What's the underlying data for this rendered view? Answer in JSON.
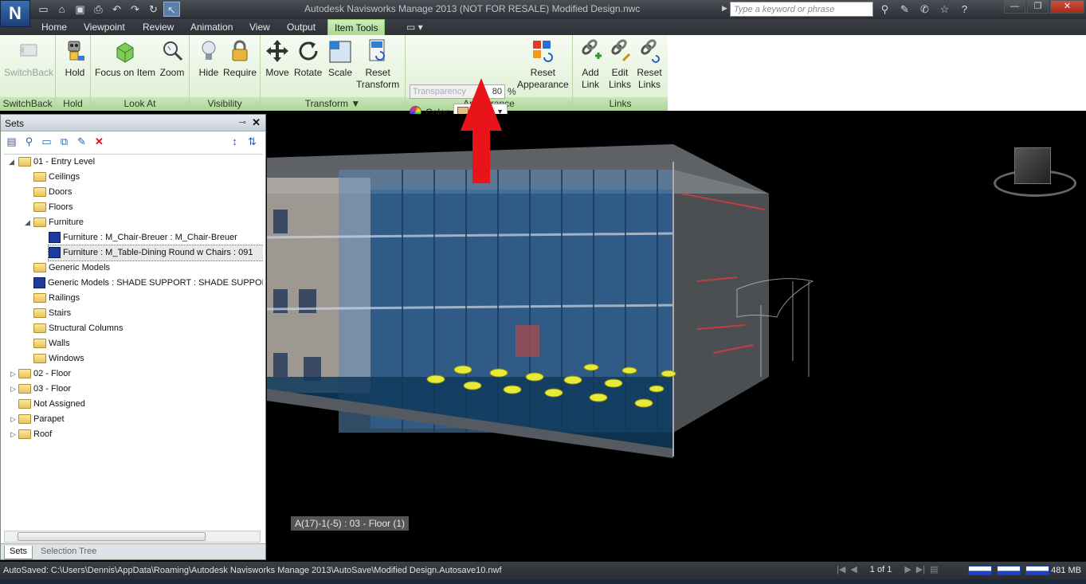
{
  "window": {
    "title": "Autodesk Navisworks Manage 2013 (NOT FOR RESALE)    Modified Design.nwc",
    "search_placeholder": "Type a keyword or phrase",
    "logo_letter": "N",
    "controls": {
      "minimize": "—",
      "restore": "❐",
      "close": "✕"
    }
  },
  "qat_icons": [
    "new-file-icon",
    "open-icon",
    "save-icon",
    "print-icon",
    "undo-icon",
    "redo-icon",
    "refresh-icon",
    "select-icon"
  ],
  "tabs": [
    {
      "label": "Home"
    },
    {
      "label": "Viewpoint"
    },
    {
      "label": "Review"
    },
    {
      "label": "Animation"
    },
    {
      "label": "View"
    },
    {
      "label": "Output"
    },
    {
      "label": "Item Tools"
    }
  ],
  "ribbon": {
    "switchback": {
      "button": "SwitchBack",
      "panel": "SwitchBack"
    },
    "hold": {
      "button": "Hold",
      "panel": "Hold"
    },
    "lookat": {
      "focus": "Focus on Item",
      "zoom": "Zoom",
      "panel": "Look At"
    },
    "visibility": {
      "hide": "Hide",
      "require": "Require",
      "panel": "Visibility"
    },
    "transform": {
      "move": "Move",
      "rotate": "Rotate",
      "scale": "Scale",
      "reset_1": "Reset",
      "reset_2": "Transform",
      "panel": "Transform ▼"
    },
    "appearance": {
      "transparency_placeholder": "Transparency",
      "transparency_value": "80",
      "unit": "%",
      "color_label": "Color:",
      "color_swatch": "#e1c08d",
      "reset_1": "Reset",
      "reset_2": "Appearance",
      "panel": "Appearance"
    },
    "links": {
      "add_1": "Add",
      "add_2": "Link",
      "edit_1": "Edit",
      "edit_2": "Links",
      "reset_1": "Reset",
      "reset_2": "Links",
      "panel": "Links"
    }
  },
  "sets_panel": {
    "title": "Sets",
    "tree": [
      {
        "label": "01 - Entry Level",
        "kind": "folder",
        "level": 0,
        "expanded": true
      },
      {
        "label": "Ceilings",
        "kind": "folder",
        "level": 1
      },
      {
        "label": "Doors",
        "kind": "folder",
        "level": 1
      },
      {
        "label": "Floors",
        "kind": "folder",
        "level": 1
      },
      {
        "label": "Furniture",
        "kind": "folder",
        "level": 1,
        "expanded": true
      },
      {
        "label": "Furniture : M_Chair-Breuer : M_Chair-Breuer",
        "kind": "item",
        "level": 2
      },
      {
        "label": "Furniture : M_Table-Dining Round w Chairs : 091",
        "kind": "item",
        "level": 2,
        "selected": true
      },
      {
        "label": "Generic Models",
        "kind": "folder",
        "level": 1
      },
      {
        "label": "Generic Models : SHADE SUPPORT : SHADE SUPPORT",
        "kind": "item",
        "level": 1
      },
      {
        "label": "Railings",
        "kind": "folder",
        "level": 1
      },
      {
        "label": "Stairs",
        "kind": "folder",
        "level": 1
      },
      {
        "label": "Structural Columns",
        "kind": "folder",
        "level": 1
      },
      {
        "label": "Walls",
        "kind": "folder",
        "level": 1
      },
      {
        "label": "Windows",
        "kind": "folder",
        "level": 1
      },
      {
        "label": "02 - Floor",
        "kind": "folder",
        "level": 0
      },
      {
        "label": "03 - Floor",
        "kind": "folder",
        "level": 0
      },
      {
        "label": "Not Assigned",
        "kind": "folder",
        "level": 0
      },
      {
        "label": "Parapet",
        "kind": "folder",
        "level": 0
      },
      {
        "label": "Roof",
        "kind": "folder",
        "level": 0
      }
    ],
    "bottom_tabs": [
      {
        "label": "Sets"
      },
      {
        "label": "Selection Tree"
      }
    ]
  },
  "viewport": {
    "coord_label": "A(17)-1(-5) : 03 - Floor (1)"
  },
  "statusbar": {
    "text": "AutoSaved: C:\\Users\\Dennis\\AppData\\Roaming\\Autodesk Navisworks Manage 2013\\AutoSave\\Modified Design.Autosave10.nwf",
    "page": "1 of 1",
    "memory": "481 MB"
  }
}
